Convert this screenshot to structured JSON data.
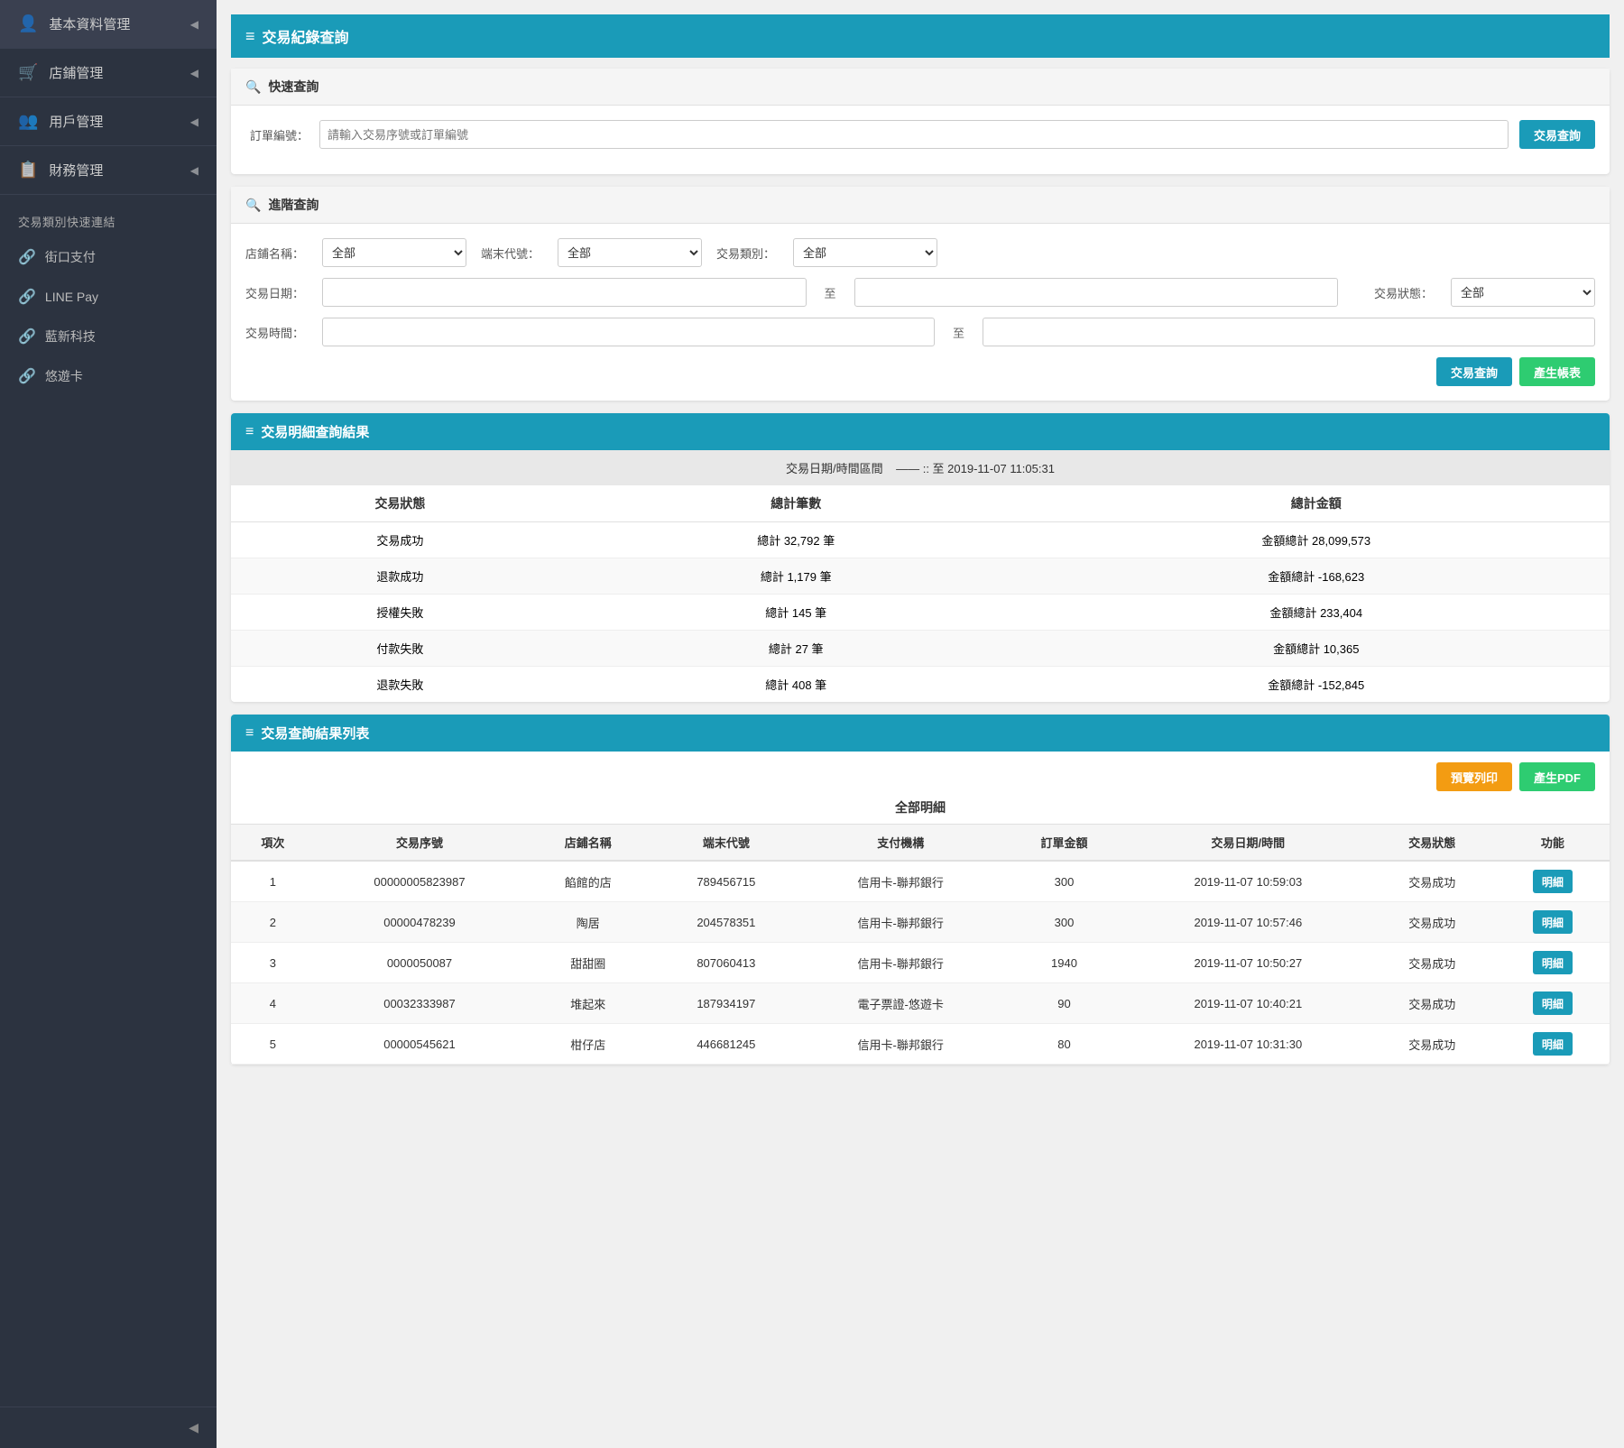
{
  "sidebar": {
    "items": [
      {
        "id": "basic",
        "label": "基本資料管理",
        "icon": "👤"
      },
      {
        "id": "store",
        "label": "店鋪管理",
        "icon": "🛒"
      },
      {
        "id": "user",
        "label": "用戶管理",
        "icon": "👥"
      },
      {
        "id": "finance",
        "label": "財務管理",
        "icon": "📋"
      }
    ],
    "section_title": "交易類別快速連結",
    "links": [
      {
        "label": "街口支付"
      },
      {
        "label": "LINE Pay"
      },
      {
        "label": "藍新科技"
      },
      {
        "label": "悠遊卡"
      }
    ],
    "collapse_icon": "◀"
  },
  "page_header": {
    "icon": "≡",
    "title": "交易紀錄查詢"
  },
  "quick_search": {
    "header": "快速查詢",
    "order_label": "訂單編號：",
    "order_placeholder": "請輸入交易序號或訂單編號",
    "search_btn": "交易查詢"
  },
  "advanced_search": {
    "header": "進階查詢",
    "store_label": "店鋪名稱：",
    "store_default": "全部",
    "terminal_label": "端末代號：",
    "terminal_default": "全部",
    "type_label": "交易類別：",
    "type_default": "全部",
    "date_label": "交易日期：",
    "date_to": "至",
    "status_label": "交易狀態：",
    "status_default": "全部",
    "time_label": "交易時間：",
    "time_to": "至",
    "search_btn": "交易查詢",
    "generate_btn": "產生帳表"
  },
  "summary": {
    "header": "交易明細查詢結果",
    "date_range_label": "交易日期/時間區間",
    "date_range_value": "—— :: 至 2019-11-07 11:05:31",
    "col_status": "交易狀態",
    "col_count": "總計筆數",
    "col_amount": "總計金額",
    "rows": [
      {
        "status": "交易成功",
        "count": "總計 32,792 筆",
        "amount": "金額總計 28,099,573"
      },
      {
        "status": "退款成功",
        "count": "總計 1,179 筆",
        "amount": "金額總計 -168,623"
      },
      {
        "status": "授權失敗",
        "count": "總計 145 筆",
        "amount": "金額總計 233,404"
      },
      {
        "status": "付款失敗",
        "count": "總計 27 筆",
        "amount": "金額總計 10,365"
      },
      {
        "status": "退款失敗",
        "count": "總計 408 筆",
        "amount": "金額總計 -152,845"
      }
    ]
  },
  "results": {
    "header": "交易查詢結果列表",
    "print_btn": "預覽列印",
    "pdf_btn": "產生PDF",
    "subtitle": "全部明細",
    "columns": [
      "項次",
      "交易序號",
      "店鋪名稱",
      "端末代號",
      "支付機構",
      "訂單金額",
      "交易日期/時間",
      "交易狀態",
      "功能"
    ],
    "rows": [
      {
        "no": "1",
        "txn": "00000005823987",
        "store": "餡館的店",
        "terminal": "789456715",
        "payment": "信用卡-聯邦銀行",
        "amount": "300",
        "datetime": "2019-11-07 10:59:03",
        "status": "交易成功",
        "btn": "明細"
      },
      {
        "no": "2",
        "txn": "00000478239",
        "store": "陶居",
        "terminal": "204578351",
        "payment": "信用卡-聯邦銀行",
        "amount": "300",
        "datetime": "2019-11-07 10:57:46",
        "status": "交易成功",
        "btn": "明細"
      },
      {
        "no": "3",
        "txn": "0000050087",
        "store": "甜甜圈",
        "terminal": "807060413",
        "payment": "信用卡-聯邦銀行",
        "amount": "1940",
        "datetime": "2019-11-07 10:50:27",
        "status": "交易成功",
        "btn": "明細"
      },
      {
        "no": "4",
        "txn": "00032333987",
        "store": "堆起來",
        "terminal": "187934197",
        "payment": "電子票證-悠遊卡",
        "amount": "90",
        "datetime": "2019-11-07 10:40:21",
        "status": "交易成功",
        "btn": "明細"
      },
      {
        "no": "5",
        "txn": "00000545621",
        "store": "柑仔店",
        "terminal": "446681245",
        "payment": "信用卡-聯邦銀行",
        "amount": "80",
        "datetime": "2019-11-07 10:31:30",
        "status": "交易成功",
        "btn": "明細"
      }
    ]
  }
}
